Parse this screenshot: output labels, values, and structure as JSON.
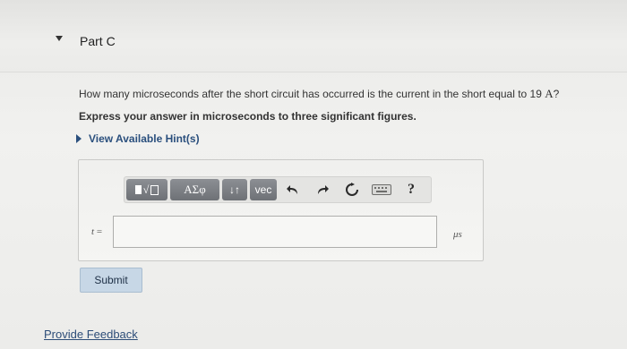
{
  "part": {
    "title": "Part C"
  },
  "question": {
    "text": "How many microseconds after the short circuit has occurred is the current in the short equal to 19",
    "unit_symbol": "A",
    "end": "?"
  },
  "instruction": "Express your answer in microseconds to three significant figures.",
  "hints": {
    "label": "View Available Hint(s)"
  },
  "toolbar": {
    "greek_label": "ΑΣφ",
    "arrows_label": "↓↑",
    "vec_label": "vec",
    "sqrt_label": "√",
    "help_label": "?"
  },
  "answer": {
    "variable": "t",
    "equals": "=",
    "value": "",
    "unit": "μs"
  },
  "submit": {
    "label": "Submit"
  },
  "feedback": {
    "label": "Provide Feedback"
  }
}
